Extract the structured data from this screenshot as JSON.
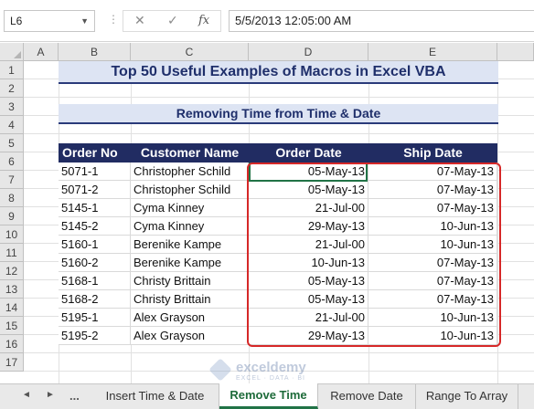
{
  "formula_bar": {
    "name_box": "L6",
    "cancel_icon": "x-icon",
    "enter_icon": "check-icon",
    "function_label": "fx",
    "formula": "5/5/2013  12:05:00 AM"
  },
  "columns": [
    "A",
    "B",
    "C",
    "D",
    "E"
  ],
  "rows": [
    "1",
    "2",
    "3",
    "4",
    "5",
    "6",
    "7",
    "8",
    "9",
    "10",
    "11",
    "12",
    "13",
    "14",
    "15",
    "16",
    "17"
  ],
  "title": "Top 50 Useful Examples of Macros in Excel VBA",
  "subtitle": "Removing Time from Time & Date",
  "table": {
    "headers": [
      "Order No",
      "Customer Name",
      "Order Date",
      "Ship Date"
    ],
    "rows": [
      [
        "5071-1",
        "Christopher Schild",
        "05-May-13",
        "07-May-13"
      ],
      [
        "5071-2",
        "Christopher Schild",
        "05-May-13",
        "07-May-13"
      ],
      [
        "5145-1",
        "Cyma Kinney",
        "21-Jul-00",
        "07-May-13"
      ],
      [
        "5145-2",
        "Cyma Kinney",
        "29-May-13",
        "10-Jun-13"
      ],
      [
        "5160-1",
        "Berenike Kampe",
        "21-Jul-00",
        "10-Jun-13"
      ],
      [
        "5160-2",
        "Berenike Kampe",
        "10-Jun-13",
        "07-May-13"
      ],
      [
        "5168-1",
        "Christy Brittain",
        "05-May-13",
        "07-May-13"
      ],
      [
        "5168-2",
        "Christy Brittain",
        "05-May-13",
        "07-May-13"
      ],
      [
        "5195-1",
        "Alex Grayson",
        "21-Jul-00",
        "10-Jun-13"
      ],
      [
        "5195-2",
        "Alex Grayson",
        "29-May-13",
        "10-Jun-13"
      ]
    ]
  },
  "watermark": {
    "name": "exceldemy",
    "tagline": "EXCEL · DATA · BI"
  },
  "tabs": {
    "nav_prev": "◄",
    "nav_next": "►",
    "more": "...",
    "items": [
      "Insert Time & Date",
      "Remove Time",
      "Remove Date",
      "Range To Array"
    ],
    "active": "Remove Time"
  },
  "colors": {
    "header_bg": "#212c62",
    "banner_bg": "#dde4f3",
    "highlight": "#d62828",
    "excel_green": "#217346"
  }
}
